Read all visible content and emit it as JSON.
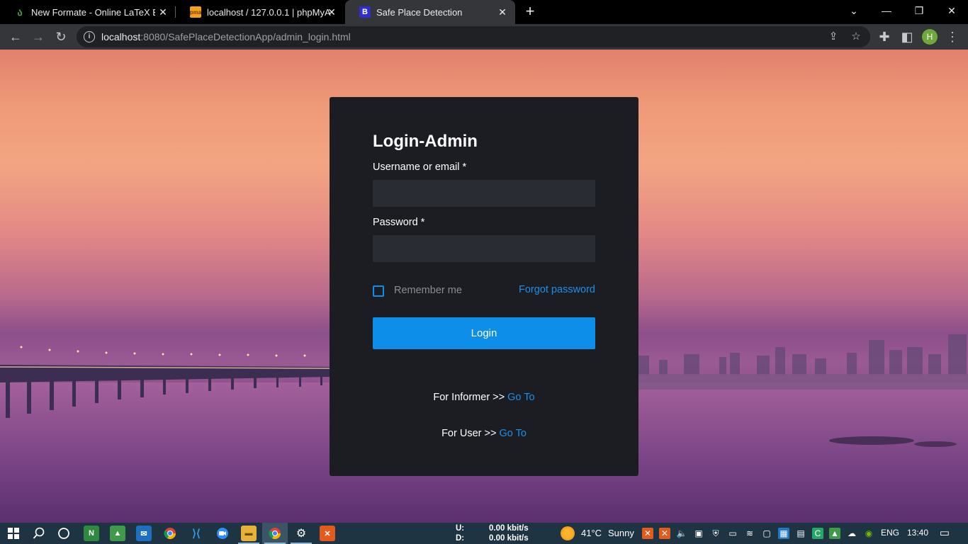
{
  "browser": {
    "tabs": [
      {
        "title": "New Formate - Online LaTeX Edit",
        "favicon": "overleaf-icon",
        "active": false
      },
      {
        "title": "localhost / 127.0.0.1 | phpMyAdm",
        "favicon": "phpmyadmin-icon",
        "active": false
      },
      {
        "title": "Safe Place Detection",
        "favicon": "bootstrap-icon",
        "active": true
      }
    ],
    "address": {
      "host": "localhost",
      "rest": ":8080/SafePlaceDetectionApp/admin_login.html"
    },
    "profile_initial": "H"
  },
  "login": {
    "title": "Login-Admin",
    "username_label": "Username or email *",
    "username_value": "",
    "password_label": "Password *",
    "password_value": "",
    "remember_label": "Remember me",
    "remember_checked": false,
    "forgot_label": "Forgot password",
    "login_button": "Login",
    "informer_text": "For Informer >>",
    "informer_link": "Go To",
    "user_text": "For User >>",
    "user_link": "Go To"
  },
  "colors": {
    "accent": "#0d8ee8",
    "card": "#1c1d23",
    "field": "#2a2c33"
  },
  "taskbar": {
    "net_up_label": "U:",
    "net_down_label": "D:",
    "net_up": "0.00 kbit/s",
    "net_down": "0.00 kbit/s",
    "temperature": "41°C",
    "weather": "Sunny",
    "language": "ENG",
    "time": "13:40"
  }
}
